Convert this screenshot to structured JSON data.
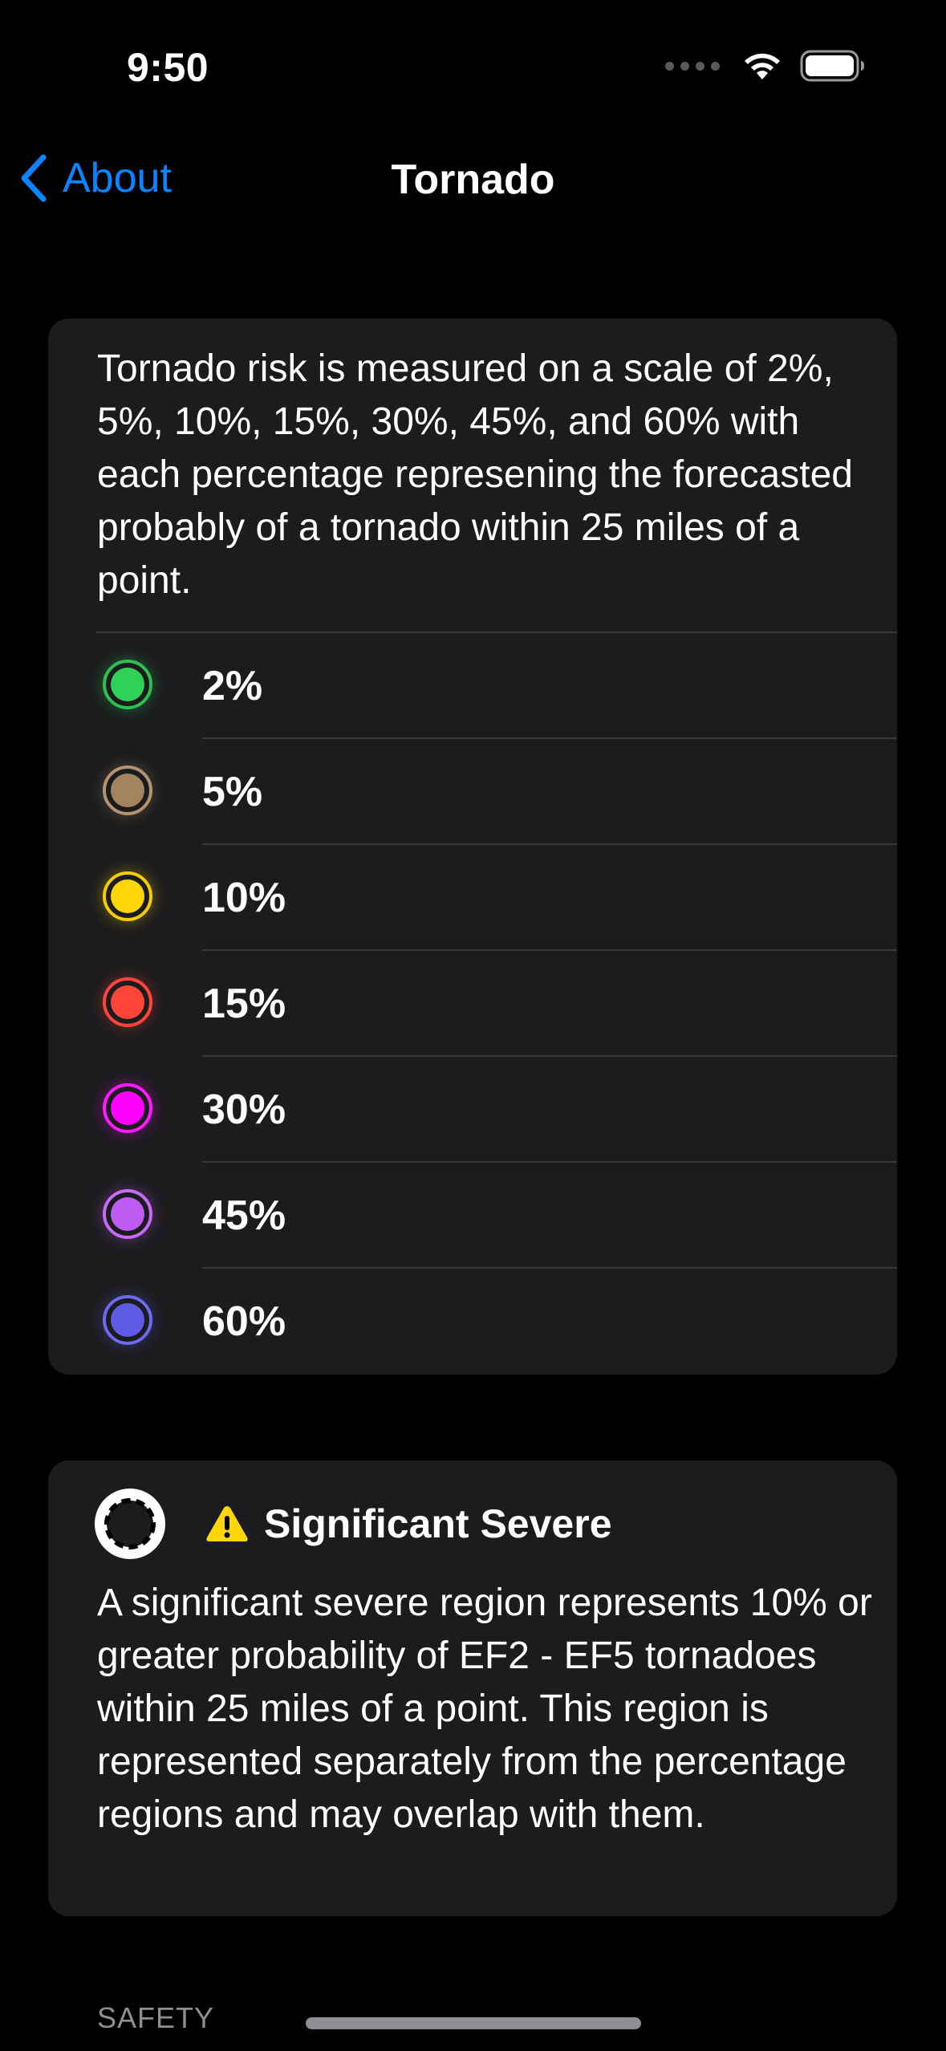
{
  "status_bar": {
    "time": "9:50"
  },
  "nav": {
    "back_label": "About",
    "title": "Tornado"
  },
  "scale_card": {
    "intro": "Tornado risk is measured on a scale of 2%, 5%, 10%, 15%, 30%, 45%, and 60% with each percentage represening the forecasted probably of a tornado within 25 miles of a point.",
    "levels": [
      {
        "label": "2%",
        "color": "#30d158",
        "ring": "#2fbf50"
      },
      {
        "label": "5%",
        "color": "#a2845e",
        "ring": "#b39472"
      },
      {
        "label": "10%",
        "color": "#ffd60a",
        "ring": "#f5cc00"
      },
      {
        "label": "15%",
        "color": "#ff453a",
        "ring": "#ff453a"
      },
      {
        "label": "30%",
        "color": "#ff00ff",
        "ring": "#ff1aff"
      },
      {
        "label": "45%",
        "color": "#bf5af2",
        "ring": "#c76af5"
      },
      {
        "label": "60%",
        "color": "#5e5ce6",
        "ring": "#6b69f0"
      }
    ]
  },
  "significant_card": {
    "icon": "dashed-circle-icon",
    "warning_icon": "warning-triangle-icon",
    "title": "Significant Severe",
    "description": "A significant severe region represents 10% or greater probability of EF2 - EF5 tornadoes within 25 miles of a point. This region is represented separately from the percentage regions and may overlap with them."
  },
  "sections": {
    "next_header": "SAFETY"
  },
  "colors": {
    "accent": "#0a84ff",
    "card_bg": "#1c1c1e",
    "separator": "#38383a"
  }
}
